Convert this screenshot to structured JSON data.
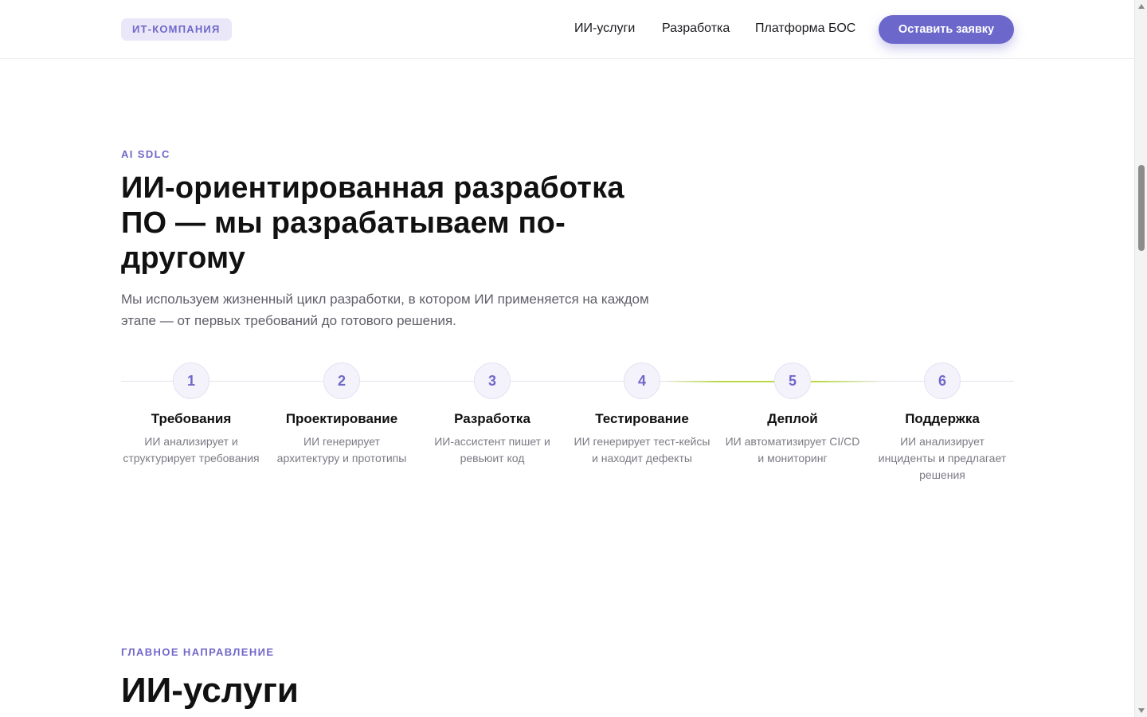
{
  "header": {
    "logo": "ИТ-КОМПАНИЯ",
    "nav": [
      "ИИ-услуги",
      "Разработка",
      "Платформа БОС"
    ],
    "cta": "Оставить заявку"
  },
  "hero": {
    "eyebrow": "AI SDLC",
    "title": "ИИ-ориентированная разработка ПО — мы разрабатываем по-другому",
    "subtitle": "Мы используем жизненный цикл разработки, в котором ИИ применяется на каждом этапе — от первых требований до готового решения."
  },
  "steps": [
    {
      "num": "1",
      "title": "Требования",
      "desc": "ИИ анализирует и структурирует требования"
    },
    {
      "num": "2",
      "title": "Проектирование",
      "desc": "ИИ генерирует архитектуру и прототипы"
    },
    {
      "num": "3",
      "title": "Разработка",
      "desc": "ИИ-ассистент пишет и ревьюит код"
    },
    {
      "num": "4",
      "title": "Тестирование",
      "desc": "ИИ генерирует тест-кейсы и находит дефекты"
    },
    {
      "num": "5",
      "title": "Деплой",
      "desc": "ИИ автоматизирует CI/CD и мониторинг"
    },
    {
      "num": "6",
      "title": "Поддержка",
      "desc": "ИИ анализирует инциденты и предлагает решения"
    }
  ],
  "section2": {
    "eyebrow": "ГЛАВНОЕ НАПРАВЛЕНИЕ",
    "title": "ИИ-услуги"
  },
  "colors": {
    "accent": "#6c67cb",
    "progress": "#b7d94a"
  }
}
